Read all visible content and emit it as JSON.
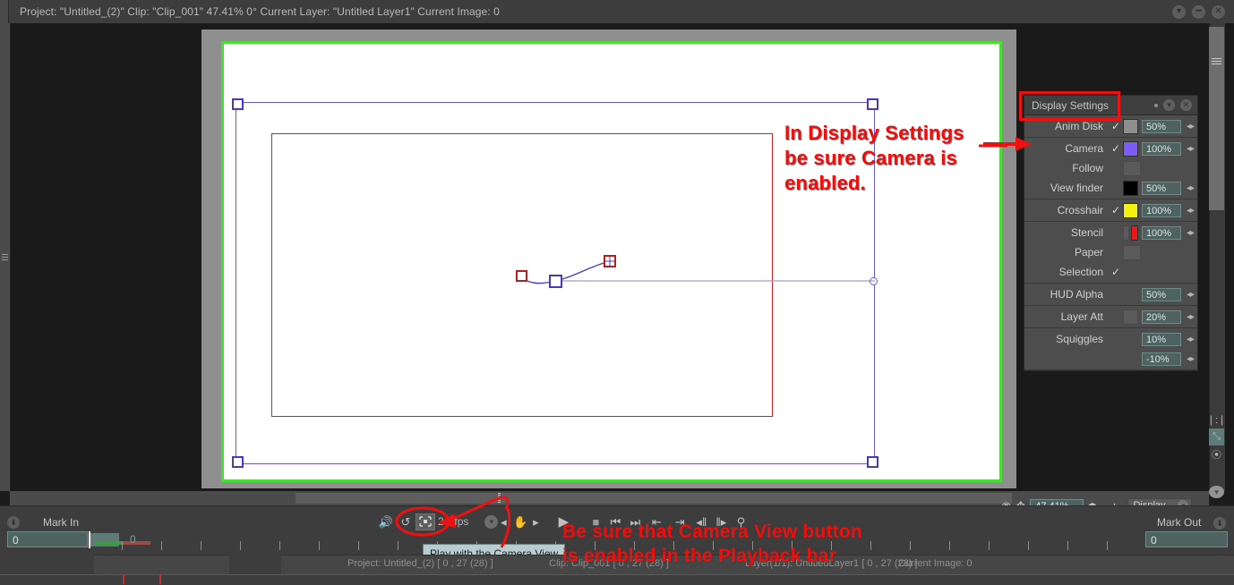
{
  "titlebar": {
    "info": "Project:  \"Untitled_(2)\"   Clip: \"Clip_001\"    47.41%    0°   Current Layer: \"Untitled Layer1\"   Current Image: 0",
    "btn_collapse": "▾",
    "btn_minimize": "━",
    "btn_close": "✕"
  },
  "display_settings": {
    "title": "Display Settings",
    "header_dot": "",
    "btn_collapse": "▾",
    "btn_close": "✕",
    "check_glyph": "✓",
    "arrows_glyph": "◂▸",
    "rows": [
      {
        "label": "Anim Disk",
        "checked": true,
        "swatch": "#8e8e8e",
        "value": "50%",
        "has_value": true,
        "has_swatch": true,
        "has_arrows": true,
        "has_ghost": false
      },
      {
        "label": "Camera",
        "checked": true,
        "swatch": "#7d5cf5",
        "value": "100%",
        "has_value": true,
        "has_swatch": true,
        "has_arrows": true,
        "has_ghost": false
      },
      {
        "label": "Follow",
        "checked": false,
        "swatch": "",
        "value": "",
        "has_value": false,
        "has_swatch": false,
        "has_arrows": false,
        "has_ghost": true
      },
      {
        "label": "View finder",
        "checked": false,
        "swatch": "#000000",
        "value": "50%",
        "has_value": true,
        "has_swatch": true,
        "has_arrows": true,
        "has_ghost": false
      },
      {
        "label": "Crosshair",
        "checked": true,
        "swatch": "#f2f20d",
        "value": "100%",
        "has_value": true,
        "has_swatch": true,
        "has_arrows": true,
        "has_ghost": false
      },
      {
        "label": "Stencil",
        "checked": false,
        "swatch": "#f31616",
        "value": "100%",
        "has_value": true,
        "has_swatch": true,
        "has_arrows": true,
        "has_ghost": true
      },
      {
        "label": "Paper",
        "checked": false,
        "swatch": "",
        "value": "",
        "has_value": false,
        "has_swatch": false,
        "has_arrows": false,
        "has_ghost": true
      },
      {
        "label": "Selection",
        "checked": true,
        "swatch": "",
        "value": "",
        "has_value": false,
        "has_swatch": false,
        "has_arrows": false,
        "has_ghost": false
      },
      {
        "label": "HUD Alpha",
        "checked": false,
        "swatch": "",
        "value": "50%",
        "has_value": true,
        "has_swatch": false,
        "has_arrows": true,
        "has_ghost": false
      },
      {
        "label": "Layer Att",
        "checked": false,
        "swatch": "",
        "value": "20%",
        "has_value": true,
        "has_swatch": false,
        "has_arrows": true,
        "has_ghost": true
      },
      {
        "label": "Squiggles",
        "checked": false,
        "swatch": "",
        "value": "10%",
        "has_value": true,
        "has_swatch": false,
        "has_arrows": true,
        "has_ghost": false
      },
      {
        "label": "",
        "checked": false,
        "swatch": "",
        "value": "-10%",
        "has_value": true,
        "has_swatch": false,
        "has_arrows": true,
        "has_ghost": false
      }
    ],
    "group_breaks": [
      0,
      3,
      4,
      7,
      8,
      9,
      11
    ]
  },
  "annotations": {
    "top_right": "In Display Settings\nbe sure Camera is\nenabled.",
    "bottom": "Be sure that Camera View button\nis enabled in the Playback bar",
    "accent_color": "#f20d0d"
  },
  "tooltip": {
    "text": "Play with the Camera View"
  },
  "viewer_bottom": {
    "zoom_value": "47.41%",
    "minus": "−",
    "plus": "+",
    "arrows_glyph": "◂▸",
    "display_label": "Display",
    "display_chevron": "▾"
  },
  "playback": {
    "mark_in_label": "Mark In",
    "mark_in_value": "0",
    "mark_out_label": "Mark Out",
    "mark_out_value": "0",
    "frame_zero_label": "0",
    "fps_value": "24",
    "fps_label": "fps",
    "fps_dropdown_glyph": "▾",
    "circle_btn_glyph": "⬇",
    "buttons": [
      {
        "name": "sound-toggle",
        "glyph": "🔊"
      },
      {
        "name": "loop-toggle",
        "glyph": "↺"
      },
      {
        "name": "camera-view-toggle",
        "glyph": "⬚"
      },
      {
        "name": "hand-left",
        "glyph": "◂"
      },
      {
        "name": "hand-tool",
        "glyph": "✋"
      },
      {
        "name": "hand-right",
        "glyph": "▸"
      },
      {
        "name": "play",
        "glyph": "▶"
      },
      {
        "name": "stop",
        "glyph": "■"
      },
      {
        "name": "first-frame",
        "glyph": "⏮"
      },
      {
        "name": "last-frame",
        "glyph": "⏭"
      },
      {
        "name": "prev-key",
        "glyph": "⇤"
      },
      {
        "name": "next-key",
        "glyph": "⇥"
      },
      {
        "name": "step-back",
        "glyph": "◂‖"
      },
      {
        "name": "step-forward",
        "glyph": "‖▸"
      },
      {
        "name": "onion-skin",
        "glyph": "⚲"
      }
    ]
  },
  "statusbar": {
    "project": "Project: Untitled_(2) [ 0 , 27  (28) ]",
    "clip": "Clip: Clip_001 [ 0 , 27  (28) ]",
    "layer": "Layer(1/1): UntitledLayer1 [ 0 , 27  (28) ]",
    "current_image": "Current Image: 0"
  },
  "right_rail": {
    "fit_icon": "❘:❘",
    "resize_icon": "⤡",
    "camera_icon": "⦿",
    "chevron": "▾"
  },
  "canvas": {
    "paper_border_color": "#46e033",
    "camera_color": "#6a5acd",
    "stencil_color": "#cc2222"
  }
}
